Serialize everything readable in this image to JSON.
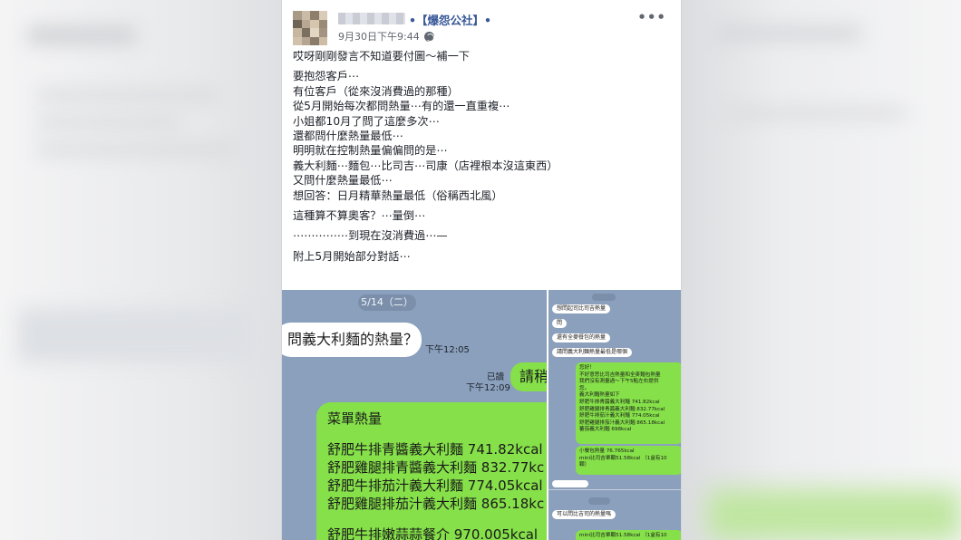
{
  "post": {
    "group_name": "•【爆怨公社】•",
    "timestamp": "9月30日下午9:44",
    "more_label": "•••",
    "lines": [
      "哎呀剛剛發言不知道要付圖～補一下",
      "",
      "要抱怨客戶⋯",
      "有位客戶（從來沒消費過的那種）",
      "從5月開始每次都問熱量⋯有的還一直重複⋯",
      "小姐都10月了問了這麼多次⋯",
      "還都問什麼熱量最低⋯",
      "明明就在控制熱量偏偏問的是⋯",
      "義大利麵⋯麵包⋯比司吉⋯司康（店裡根本沒這東西）",
      "又問什麼熱量最低⋯",
      "想回答：日月精華熱量最低（俗稱西北風）",
      "",
      "這種算不算奧客？⋯量倒⋯",
      "",
      "⋯⋯⋯⋯⋯到現在沒消費過⋯—",
      "",
      "附上5月開始部分對話⋯"
    ]
  },
  "chat_main": {
    "date": "5/14（二）",
    "incoming_text": "問義大利麵的熱量？",
    "incoming_time": "下午12:05",
    "read_label": "已讀",
    "outgoing_time": "下午12:09",
    "outgoing_small": "請稍",
    "menu_title": "菜單熱量",
    "menu_items": [
      "舒肥牛排青醬義大利麵 741.82kcal",
      "舒肥雞腿排青醬義大利麵 832.77kc",
      "舒肥牛排茄汁義大利麵 774.05kcal",
      "舒肥雞腿排茄汁義大利麵 865.18kc"
    ],
    "menu_partial": "舒肥牛排嫩蒜蒜餐介 970.005kcal"
  },
  "chat_side": {
    "messages_in": [
      "想問起司比司吉熱量",
      "問",
      "還有全麥餐包的熱量",
      "請問義大利麵熱量最低是哪個"
    ],
    "reply_1": [
      "您好！",
      "不好意思比司吉熱量和全麥麵包熱量",
      "我們沒有測量過～下午5點左右提供",
      "您。",
      "義大利麵熱量如下",
      "舒肥牛排青醬義大利麵 741.82kcal",
      "舒肥雞腿排青醬義大利麵 832.77kcal",
      "舒肥牛排茄汁義大利麵 774.05kcal",
      "舒肥雞腿排茄汁義大利麵 865.18kcal",
      "蕃茄義大利麵 698kcal"
    ],
    "reply_2": [
      "小餐包熱量 76.765kcal",
      "mini比司吉單顆51.58kcal （1盒有10",
      "顆）"
    ],
    "bottom_in": "可以問比吉司的熱量嗎",
    "bottom_out": "mini比司吉單顆51.58kcal （1盒有10"
  }
}
